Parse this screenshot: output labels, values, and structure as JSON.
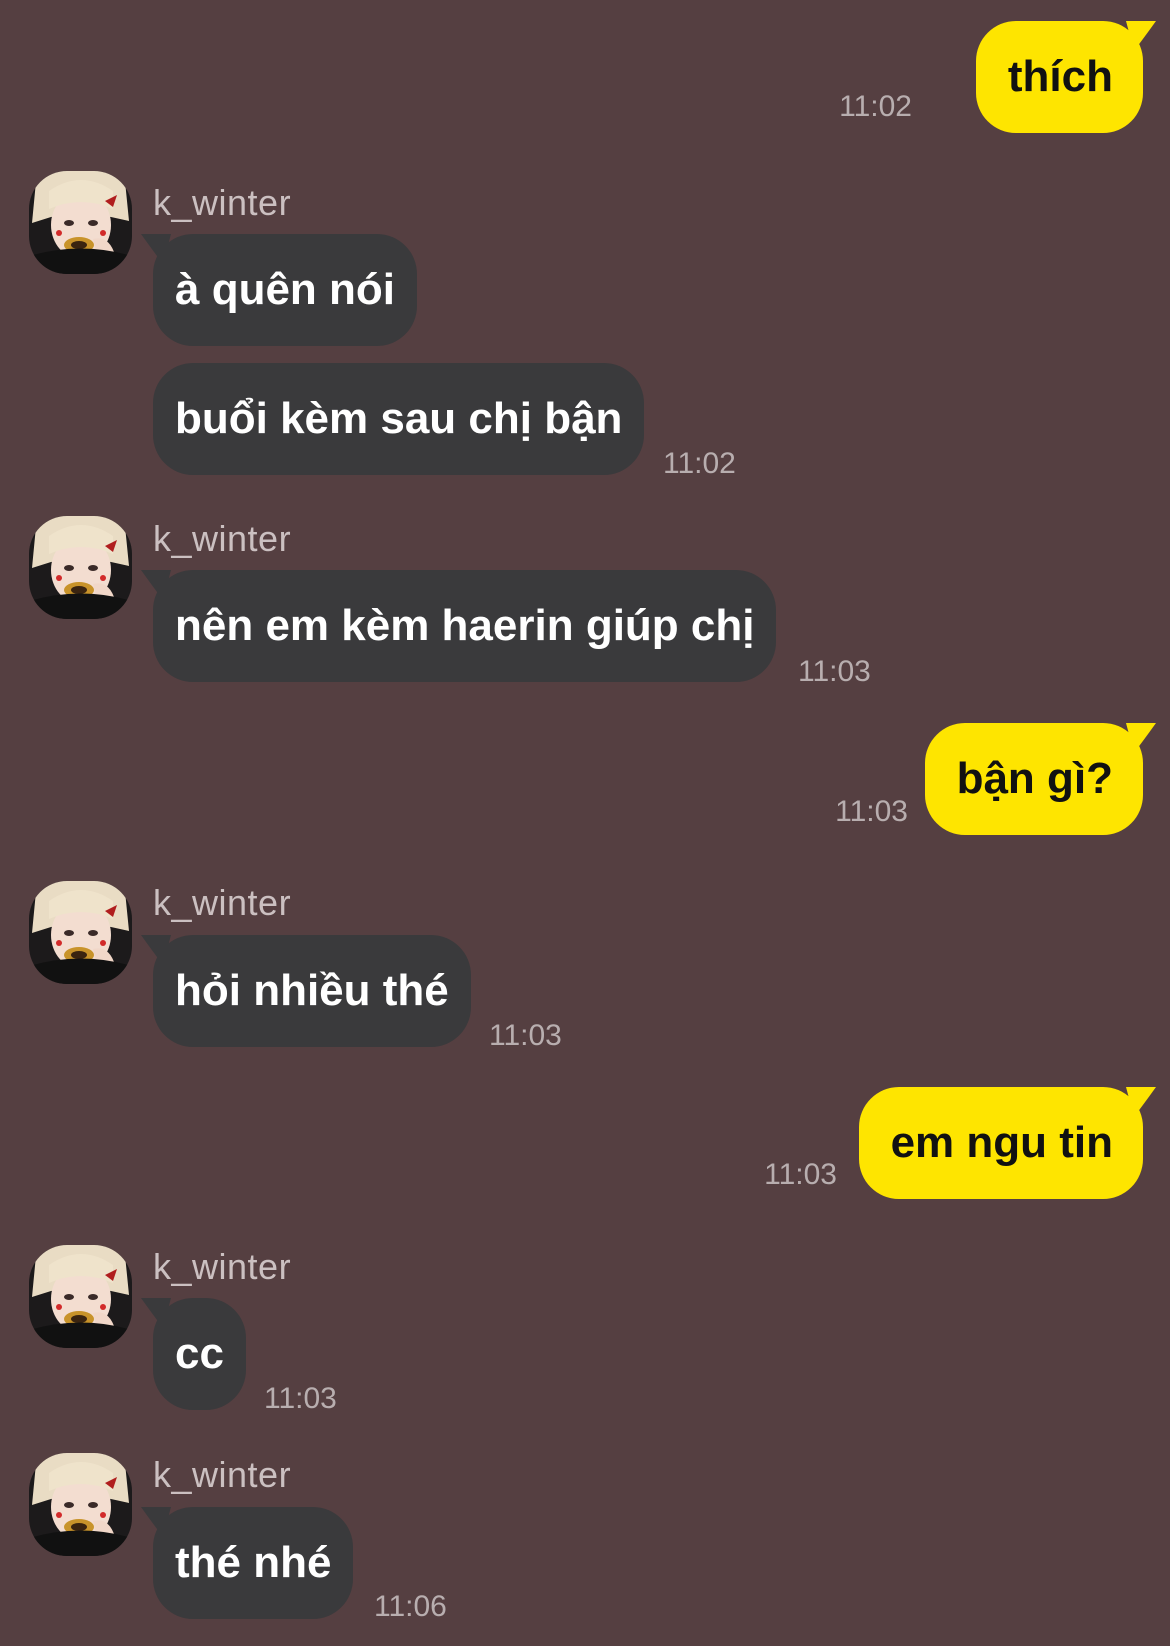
{
  "colors": {
    "background": "#553f41",
    "incoming_bubble": "#3a3a3c",
    "outgoing_bubble": "#fee500",
    "timestamp": "#b8aeaf"
  },
  "messages": [
    {
      "direction": "outgoing",
      "text": "thích",
      "time": "11:02"
    },
    {
      "direction": "incoming",
      "sender": "k_winter",
      "text": "à quên nói"
    },
    {
      "direction": "incoming",
      "text": "buổi kèm sau chị bận",
      "time": "11:02"
    },
    {
      "direction": "incoming",
      "sender": "k_winter",
      "text": "nên em kèm haerin giúp chị",
      "time": "11:03"
    },
    {
      "direction": "outgoing",
      "text": "bận gì?",
      "time": "11:03"
    },
    {
      "direction": "incoming",
      "sender": "k_winter",
      "text": "hỏi nhiều thé",
      "time": "11:03"
    },
    {
      "direction": "outgoing",
      "text": "em ngu tin",
      "time": "11:03"
    },
    {
      "direction": "incoming",
      "sender": "k_winter",
      "text": "cc",
      "time": "11:03"
    },
    {
      "direction": "incoming",
      "sender": "k_winter",
      "text": "thé nhé",
      "time": "11:06"
    }
  ]
}
